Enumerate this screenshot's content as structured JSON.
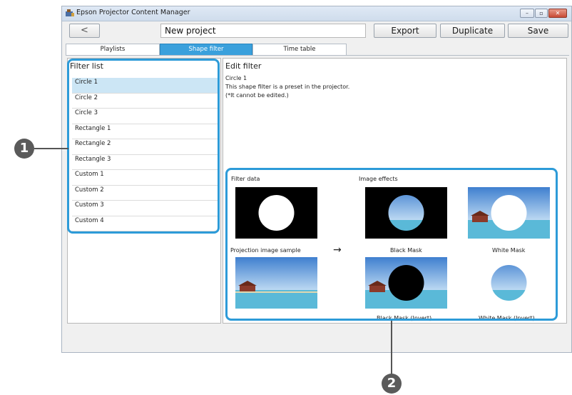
{
  "window": {
    "title": "Epson Projector Content Manager",
    "controls": [
      "minimize-icon",
      "maximize-icon",
      "close-icon"
    ]
  },
  "toolbar": {
    "back_icon": "chevron-left-icon",
    "back_label": "<",
    "project_name": "New project",
    "export_label": "Export",
    "duplicate_label": "Duplicate",
    "save_label": "Save"
  },
  "tabs": [
    {
      "label": "Playlists",
      "active": false
    },
    {
      "label": "Shape filter",
      "active": true
    },
    {
      "label": "Time table",
      "active": false
    }
  ],
  "filter_list": {
    "title": "Filter list",
    "items": [
      "Circle 1",
      "Circle 2",
      "Circle 3",
      "Rectangle 1",
      "Rectangle 2",
      "Rectangle 3",
      "Custom 1",
      "Custom 2",
      "Custom 3",
      "Custom 4"
    ],
    "selected": "Circle 1"
  },
  "edit_filter": {
    "title": "Edit filter",
    "name": "Circle 1",
    "description_1": "This shape filter is a preset in the projector.",
    "description_2": "(*It cannot be edited.)"
  },
  "filter_data": {
    "label": "Filter data",
    "sample_label": "Projection image sample",
    "arrow": "→"
  },
  "image_effects": {
    "label": "Image effects",
    "black_mask": "Black Mask",
    "white_mask": "White Mask",
    "black_mask_invert": "Black Mask (Invert)",
    "white_mask_invert": "White Mask (Invert)"
  },
  "callouts": [
    "1",
    "2"
  ],
  "colors": {
    "accent": "#2d9bd8",
    "active_tab": "#3aa0dc",
    "selected_row": "#cce6f5",
    "callout_bubble": "#5a5a5a"
  }
}
